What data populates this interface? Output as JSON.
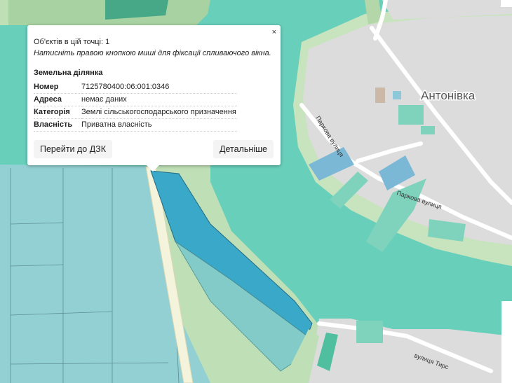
{
  "map": {
    "place_label": "Антонівка",
    "street_labels": [
      "Паркова вулиця",
      "Паркова вулиця",
      "вулиця Тирс"
    ]
  },
  "popup": {
    "close_label": "×",
    "objects_count": "Об'єктів в цій точці: 1",
    "hint": "Натисніть правою кнопкою миші для фіксації спливаючого вікна.",
    "title": "Земельна ділянка",
    "rows": [
      {
        "key": "Номер",
        "value": "7125780400:06:001:0346"
      },
      {
        "key": "Адреса",
        "value": "немає даних"
      },
      {
        "key": "Категорія",
        "value": "Землі сільськогосподарського призначення"
      },
      {
        "key": "Власність",
        "value": "Приватна власність"
      }
    ],
    "goto_button": "Перейти до ДЗК",
    "details_button": "Детальніше"
  },
  "colors": {
    "water": "#66cdba",
    "land_gray": "#dcdcdc",
    "meadow": "#b4d7a9",
    "parcel_blue": "#3aa8c8",
    "parcel_fill": "#8ecfd0"
  }
}
